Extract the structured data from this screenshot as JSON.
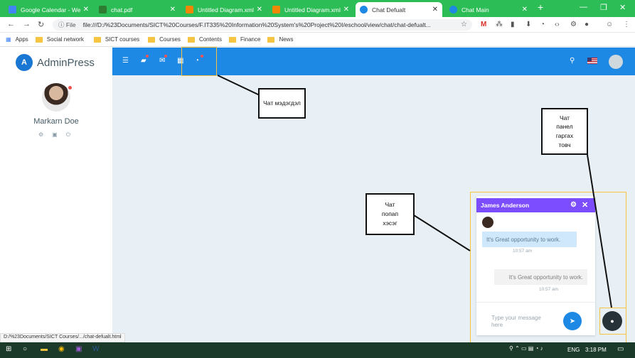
{
  "tabs": [
    {
      "label": "Google Calendar - Wee",
      "favicon_color": "#4285f4"
    },
    {
      "label": "chat.pdf",
      "favicon_color": "#2e7d32"
    },
    {
      "label": "Untitled Diagram.xml -",
      "favicon_color": "#f08705"
    },
    {
      "label": "Untitled Diagram.xml -",
      "favicon_color": "#f08705"
    },
    {
      "label": "Chat Defualt",
      "favicon_color": "#1e88e5"
    },
    {
      "label": "Chat Main",
      "favicon_color": "#1e88e5"
    }
  ],
  "address_bar": {
    "file_label": "File",
    "url": "file:///D:/%23Documents/SICT%20Courses/F.IT335%20Information%20System's%20Project%20I/eschool/view/chat/chat-defualt..."
  },
  "bookmarks": [
    "Apps",
    "Social network",
    "SICT courses",
    "Courses",
    "Contents",
    "Finance",
    "News"
  ],
  "sidebar": {
    "brand": "AdminPress",
    "logo_letter": "A",
    "user_name": "Markarn Doe"
  },
  "annotations": {
    "messages_icon": "Чат мэдэгдэл",
    "chat_popup": "Чат попап хэсэг",
    "panel_toggle": "Чат панел гаргах товч"
  },
  "chat": {
    "contact_name": "James Anderson",
    "messages": [
      {
        "text": "It's Great opportunity to work.",
        "time": "10:57 am"
      },
      {
        "text": "It's Great opportunity to work.",
        "time": "10:57 am"
      }
    ],
    "input_placeholder": "Type your message here"
  },
  "status_url": "D:/%23Documents/SICT Courses/.../chat-defualt.html",
  "taskbar": {
    "language": "ENG",
    "time": "3:18 PM"
  },
  "colors": {
    "tab_bar": "#2dbd57",
    "topbar": "#1e88e5",
    "chat_header": "#7c4dff",
    "accent_highlight": "#f6c343"
  }
}
